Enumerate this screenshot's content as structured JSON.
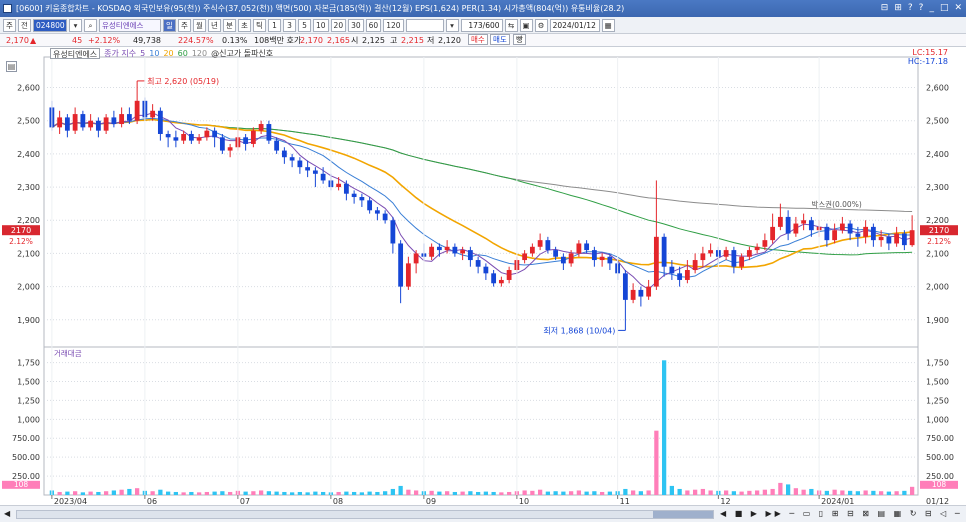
{
  "window": {
    "title": "[0600] 키움종합차트 - KOSDAQ 외국인보유(95(천)) 주식수(37,052(천)) 액면(500) 자본금(185(억)) 결산(12월) EPS(1,624) PER(1.34) 시가총액(804(억)) 유통비율(28.2)",
    "controls": [
      "⊟",
      "⊞",
      "?",
      "?",
      "_",
      "□",
      "✕"
    ]
  },
  "toolbar": {
    "btn_main": "주",
    "btn_prev": "전",
    "code": "024800",
    "stock_name": "유성티엔에스",
    "period_buttons": [
      "일",
      "주",
      "월",
      "년",
      "분",
      "초",
      "틱"
    ],
    "minute_options": [
      "1",
      "3",
      "5",
      "10",
      "20",
      "30",
      "60",
      "120"
    ],
    "count_value": "173",
    "count_max": "600",
    "date": "2024/01/12"
  },
  "quote": {
    "price": "2,170",
    "change_mark": "▲",
    "change": "45",
    "change_rate": "+2.12%",
    "volume": "49,738",
    "volume_ratio": "224.57%",
    "turnover": "0.13%",
    "amount_label": "108백만 호가",
    "ask": "2,170",
    "bid": "2,165",
    "open_label": "시",
    "open": "2,125",
    "high_label": "고",
    "high": "2,215",
    "low_label": "저",
    "low": "2,120",
    "buy_label": "매수",
    "sell_label": "매도",
    "extra_label": "빵"
  },
  "legend": {
    "stock": "유성티엔에스",
    "ma_prefix": "종가 지수",
    "ma_periods": [
      "5",
      "10",
      "20",
      "60",
      "120"
    ],
    "signal": "@신고가 돌파신호"
  },
  "top_right": {
    "lc": "LC:15.17",
    "hc": "HC:-17.18"
  },
  "volume_title": "거래대금",
  "colors": {
    "up": "#e4262b",
    "down": "#1546d6",
    "ma5": "#7b4db3",
    "ma10": "#3a7fd6",
    "ma20": "#f2a500",
    "ma60": "#2f9e44",
    "ma120": "#8c8c8c",
    "vol_up": "#ff7eb9",
    "vol_down": "#2ec4f2"
  },
  "chart_data": [
    {
      "type": "candlestick",
      "yticks": [
        "2,600",
        "2,500",
        "2,400",
        "2,300",
        "2,200",
        "2,100",
        "2,000",
        "1,900"
      ],
      "ylim": [
        1830,
        2680
      ],
      "xticks": [
        "2023/04",
        "06",
        "07",
        "08",
        "09",
        "10",
        "11",
        "12",
        "2024/01"
      ],
      "price_tags": [
        "2170",
        "2.12%"
      ],
      "annotations": {
        "high": "최고 2,620 (05/19)",
        "low": "최저 1,868 (10/04)",
        "right_label": "박스권(0.00%)"
      },
      "candles": [
        [
          2540,
          2480,
          2560,
          2470
        ],
        [
          2480,
          2510,
          2530,
          2460
        ],
        [
          2510,
          2470,
          2520,
          2450
        ],
        [
          2470,
          2520,
          2540,
          2460
        ],
        [
          2520,
          2480,
          2530,
          2470
        ],
        [
          2480,
          2500,
          2520,
          2470
        ],
        [
          2500,
          2470,
          2510,
          2450
        ],
        [
          2470,
          2510,
          2520,
          2460
        ],
        [
          2510,
          2490,
          2530,
          2480
        ],
        [
          2490,
          2520,
          2540,
          2480
        ],
        [
          2520,
          2500,
          2540,
          2490
        ],
        [
          2500,
          2560,
          2620,
          2490
        ],
        [
          2560,
          2510,
          2570,
          2500
        ],
        [
          2510,
          2530,
          2550,
          2500
        ],
        [
          2530,
          2460,
          2540,
          2440
        ],
        [
          2460,
          2450,
          2470,
          2420
        ],
        [
          2450,
          2440,
          2470,
          2420
        ],
        [
          2440,
          2460,
          2470,
          2430
        ],
        [
          2460,
          2440,
          2470,
          2430
        ],
        [
          2440,
          2450,
          2460,
          2430
        ],
        [
          2450,
          2470,
          2480,
          2440
        ],
        [
          2470,
          2450,
          2480,
          2420
        ],
        [
          2450,
          2410,
          2460,
          2400
        ],
        [
          2410,
          2420,
          2430,
          2390
        ],
        [
          2420,
          2450,
          2480,
          2410
        ],
        [
          2450,
          2430,
          2460,
          2410
        ],
        [
          2430,
          2470,
          2480,
          2420
        ],
        [
          2470,
          2490,
          2500,
          2460
        ],
        [
          2490,
          2440,
          2500,
          2430
        ],
        [
          2440,
          2410,
          2450,
          2400
        ],
        [
          2410,
          2390,
          2420,
          2370
        ],
        [
          2390,
          2380,
          2400,
          2360
        ],
        [
          2380,
          2360,
          2390,
          2340
        ],
        [
          2360,
          2350,
          2380,
          2330
        ],
        [
          2350,
          2340,
          2360,
          2300
        ],
        [
          2340,
          2320,
          2360,
          2310
        ],
        [
          2320,
          2300,
          2340,
          2290
        ],
        [
          2300,
          2310,
          2330,
          2290
        ],
        [
          2310,
          2280,
          2320,
          2260
        ],
        [
          2280,
          2270,
          2290,
          2250
        ],
        [
          2270,
          2260,
          2280,
          2240
        ],
        [
          2260,
          2230,
          2270,
          2220
        ],
        [
          2230,
          2220,
          2240,
          2200
        ],
        [
          2220,
          2200,
          2230,
          2190
        ],
        [
          2200,
          2130,
          2210,
          2100
        ],
        [
          2130,
          2000,
          2140,
          1950
        ],
        [
          2000,
          2070,
          2090,
          1990
        ],
        [
          2070,
          2100,
          2110,
          2040
        ],
        [
          2100,
          2090,
          2130,
          2080
        ],
        [
          2090,
          2120,
          2130,
          2080
        ],
        [
          2120,
          2110,
          2130,
          2090
        ],
        [
          2110,
          2120,
          2140,
          2100
        ],
        [
          2120,
          2100,
          2130,
          2090
        ],
        [
          2100,
          2110,
          2120,
          2080
        ],
        [
          2110,
          2080,
          2120,
          2060
        ],
        [
          2080,
          2060,
          2090,
          2040
        ],
        [
          2060,
          2040,
          2070,
          2020
        ],
        [
          2040,
          2010,
          2050,
          2000
        ],
        [
          2010,
          2020,
          2030,
          2000
        ],
        [
          2020,
          2050,
          2060,
          2010
        ],
        [
          2050,
          2080,
          2090,
          2040
        ],
        [
          2080,
          2100,
          2110,
          2070
        ],
        [
          2100,
          2120,
          2130,
          2090
        ],
        [
          2120,
          2140,
          2160,
          2110
        ],
        [
          2140,
          2110,
          2150,
          2100
        ],
        [
          2110,
          2090,
          2120,
          2080
        ],
        [
          2090,
          2070,
          2100,
          2050
        ],
        [
          2070,
          2100,
          2110,
          2060
        ],
        [
          2100,
          2130,
          2140,
          2090
        ],
        [
          2130,
          2110,
          2140,
          2100
        ],
        [
          2110,
          2080,
          2120,
          2060
        ],
        [
          2080,
          2090,
          2100,
          2060
        ],
        [
          2090,
          2070,
          2100,
          2050
        ],
        [
          2070,
          2040,
          2080,
          2020
        ],
        [
          2040,
          1960,
          2050,
          1868
        ],
        [
          1960,
          1990,
          2010,
          1950
        ],
        [
          1990,
          1970,
          2000,
          1940
        ],
        [
          1970,
          2000,
          2020,
          1960
        ],
        [
          2000,
          2150,
          2320,
          1990
        ],
        [
          2150,
          2060,
          2160,
          2030
        ],
        [
          2060,
          2040,
          2080,
          2020
        ],
        [
          2040,
          2020,
          2060,
          2000
        ],
        [
          2020,
          2050,
          2080,
          2010
        ],
        [
          2050,
          2080,
          2100,
          2040
        ],
        [
          2080,
          2100,
          2120,
          2060
        ],
        [
          2100,
          2110,
          2130,
          2090
        ],
        [
          2110,
          2090,
          2120,
          2070
        ],
        [
          2090,
          2110,
          2120,
          2080
        ],
        [
          2110,
          2060,
          2120,
          2040
        ],
        [
          2060,
          2090,
          2100,
          2050
        ],
        [
          2090,
          2110,
          2120,
          2080
        ],
        [
          2110,
          2120,
          2130,
          2100
        ],
        [
          2120,
          2140,
          2160,
          2110
        ],
        [
          2140,
          2180,
          2220,
          2130
        ],
        [
          2180,
          2210,
          2250,
          2170
        ],
        [
          2210,
          2160,
          2230,
          2140
        ],
        [
          2160,
          2190,
          2210,
          2150
        ],
        [
          2190,
          2200,
          2220,
          2170
        ],
        [
          2200,
          2170,
          2210,
          2150
        ],
        [
          2170,
          2180,
          2200,
          2150
        ],
        [
          2180,
          2140,
          2190,
          2120
        ],
        [
          2140,
          2170,
          2190,
          2130
        ],
        [
          2170,
          2190,
          2210,
          2160
        ],
        [
          2190,
          2160,
          2200,
          2140
        ],
        [
          2160,
          2150,
          2180,
          2120
        ],
        [
          2150,
          2180,
          2200,
          2130
        ],
        [
          2180,
          2140,
          2190,
          2120
        ],
        [
          2140,
          2150,
          2170,
          2120
        ],
        [
          2150,
          2130,
          2160,
          2110
        ],
        [
          2130,
          2160,
          2180,
          2120
        ],
        [
          2160,
          2125,
          2170,
          2110
        ],
        [
          2125,
          2170,
          2215,
          2120
        ]
      ]
    },
    {
      "type": "bar",
      "title": "거래대금",
      "yticks": [
        "1,750",
        "1,500",
        "1,250",
        "1,000",
        "750.00",
        "500.00",
        "250.00"
      ],
      "ylim": [
        0,
        1850
      ],
      "latest": "108",
      "tags": [
        "108",
        "108"
      ],
      "values": [
        60,
        40,
        45,
        50,
        35,
        45,
        40,
        50,
        60,
        70,
        80,
        90,
        55,
        50,
        70,
        45,
        40,
        35,
        40,
        35,
        40,
        45,
        50,
        40,
        55,
        45,
        50,
        60,
        50,
        45,
        40,
        35,
        40,
        35,
        45,
        40,
        35,
        40,
        45,
        40,
        35,
        45,
        40,
        50,
        80,
        120,
        70,
        60,
        50,
        55,
        45,
        50,
        40,
        45,
        50,
        40,
        45,
        40,
        35,
        40,
        50,
        60,
        55,
        70,
        45,
        50,
        45,
        50,
        60,
        45,
        50,
        40,
        45,
        50,
        80,
        60,
        50,
        60,
        850,
        1780,
        120,
        80,
        60,
        70,
        80,
        60,
        55,
        60,
        50,
        45,
        55,
        60,
        70,
        80,
        160,
        140,
        90,
        70,
        80,
        60,
        55,
        70,
        60,
        55,
        50,
        60,
        55,
        50,
        45,
        50,
        55,
        108
      ]
    }
  ]
}
